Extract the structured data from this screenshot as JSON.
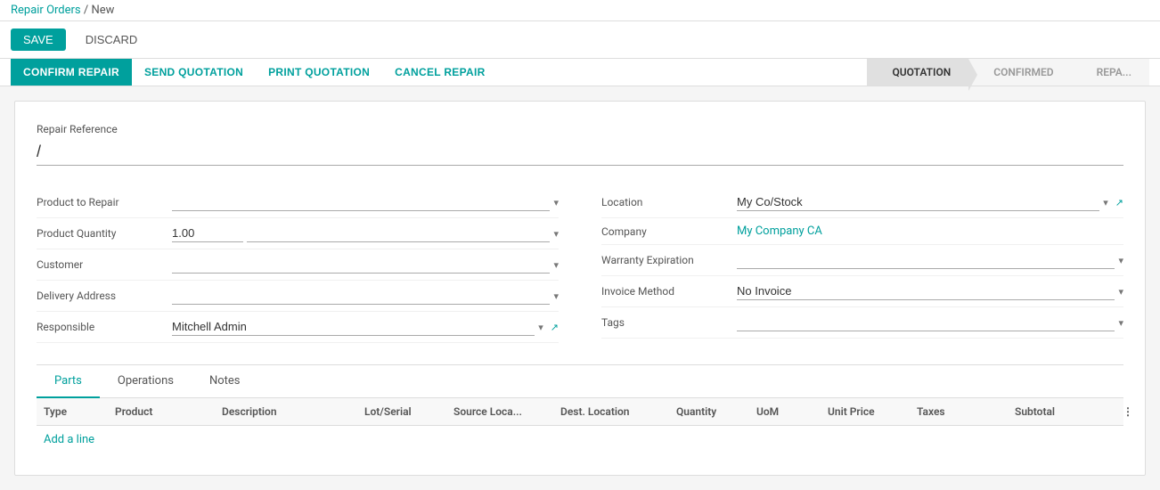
{
  "breadcrumb": {
    "parent": "Repair Orders",
    "separator": "/",
    "current": "New"
  },
  "action_bar": {
    "save_label": "SAVE",
    "discard_label": "DISCARD"
  },
  "toolbar": {
    "confirm_repair_label": "CONFIRM REPAIR",
    "send_quotation_label": "SEND QUOTATION",
    "print_quotation_label": "PRINT QUOTATION",
    "cancel_repair_label": "CANCEL REPAIR"
  },
  "status_steps": [
    {
      "label": "QUOTATION",
      "state": "active"
    },
    {
      "label": "CONFIRMED",
      "state": "inactive"
    },
    {
      "label": "REPA...",
      "state": "inactive"
    }
  ],
  "form": {
    "repair_reference_label": "Repair Reference",
    "repair_reference_value": "/",
    "left_fields": [
      {
        "label": "Product to Repair",
        "value": "",
        "type": "dropdown"
      },
      {
        "label": "Product Quantity",
        "value": "1.00",
        "type": "input"
      },
      {
        "label": "Customer",
        "value": "",
        "type": "dropdown"
      },
      {
        "label": "Delivery Address",
        "value": "",
        "type": "dropdown"
      },
      {
        "label": "Responsible",
        "value": "Mitchell Admin",
        "type": "dropdown",
        "has_external": true
      }
    ],
    "right_fields": [
      {
        "label": "Location",
        "value": "My Co/Stock",
        "type": "dropdown",
        "has_external": true
      },
      {
        "label": "Company",
        "value": "My Company CA",
        "type": "link"
      },
      {
        "label": "Warranty Expiration",
        "value": "",
        "type": "dropdown"
      },
      {
        "label": "Invoice Method",
        "value": "No Invoice",
        "type": "dropdown"
      },
      {
        "label": "Tags",
        "value": "",
        "type": "dropdown"
      }
    ]
  },
  "tabs": [
    {
      "label": "Parts",
      "active": true
    },
    {
      "label": "Operations",
      "active": false
    },
    {
      "label": "Notes",
      "active": false
    }
  ],
  "table": {
    "columns": [
      "Type",
      "Product",
      "Description",
      "Lot/Serial",
      "Source Loca...",
      "Dest. Location",
      "Quantity",
      "UoM",
      "Unit Price",
      "Taxes",
      "Subtotal",
      ""
    ],
    "rows": [],
    "add_line_label": "Add a line"
  },
  "icons": {
    "chevron": "▾",
    "external_link": "↗",
    "options": "⋮"
  }
}
